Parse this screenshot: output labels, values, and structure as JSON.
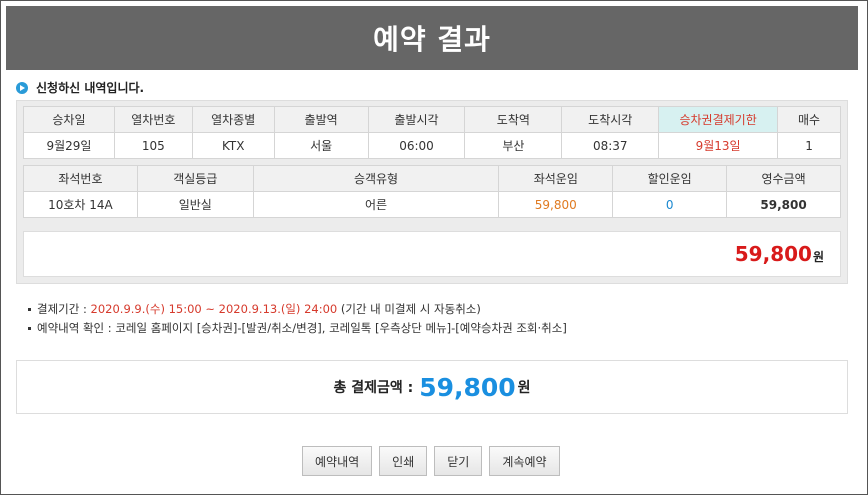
{
  "page": {
    "title": "예약 결과"
  },
  "section": {
    "heading": "신청하신 내역입니다."
  },
  "train_table": {
    "headers": [
      "승차일",
      "열차번호",
      "열차종별",
      "출발역",
      "출발시각",
      "도착역",
      "도착시각",
      "승차권결제기한",
      "매수"
    ],
    "row": [
      "9월29일",
      "105",
      "KTX",
      "서울",
      "06:00",
      "부산",
      "08:37",
      "9월13일",
      "1"
    ]
  },
  "seat_table": {
    "headers": [
      "좌석번호",
      "객실등급",
      "승객유형",
      "좌석운임",
      "할인운임",
      "영수금액"
    ],
    "row": [
      "10호차 14A",
      "일반실",
      "어른",
      "59,800",
      "0",
      "59,800"
    ]
  },
  "total": {
    "amount": "59,800",
    "unit": "원"
  },
  "notes": {
    "deadline_label": "결제기간 : ",
    "deadline_period": "2020.9.9.(수) 15:00 ~ 2020.9.13.(일) 24:00",
    "deadline_suffix": " (기간 내 미결제 시 자동취소)",
    "confirm": "예약내역 확인 : 코레일 홈페이지 [승차권]-[발권/취소/변경], 코레일톡 [우측상단 메뉴]-[예약승차권 조회·취소]"
  },
  "payment": {
    "label": "총 결제금액 : ",
    "amount": "59,800",
    "unit": "원"
  },
  "buttons": {
    "history": "예약내역",
    "print": "인쇄",
    "close": "닫기",
    "continue": "계속예약"
  },
  "colors": {
    "accent_blue": "#1a8fe0",
    "accent_red": "#d81a1a",
    "header_bg": "#666666"
  }
}
